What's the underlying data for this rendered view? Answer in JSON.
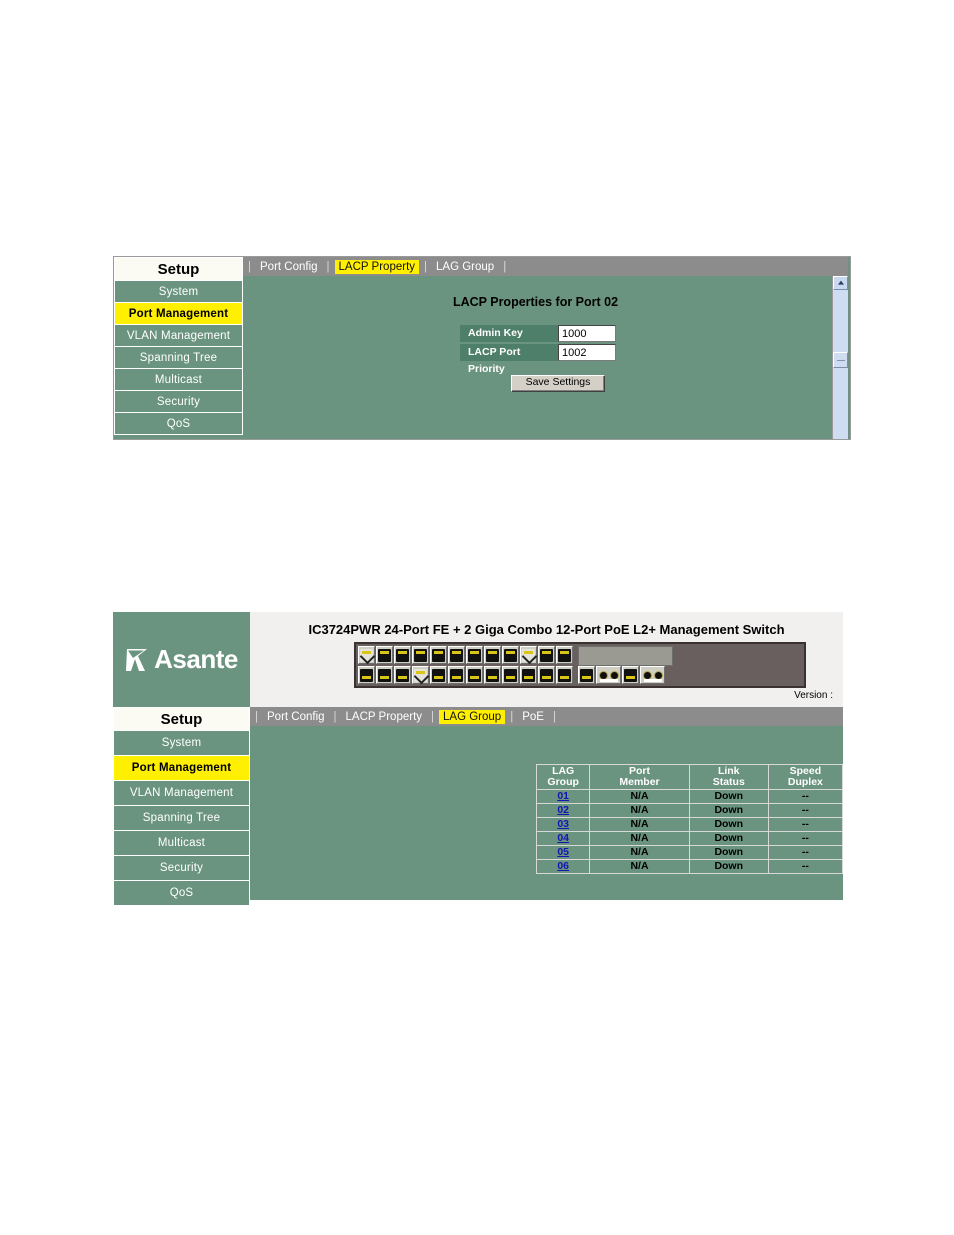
{
  "sidebar": {
    "header": "Setup",
    "items": [
      {
        "label": "System",
        "active": false
      },
      {
        "label": "Port Management",
        "active": true
      },
      {
        "label": "VLAN Management",
        "active": false
      },
      {
        "label": "Spanning Tree",
        "active": false
      },
      {
        "label": "Multicast",
        "active": false
      },
      {
        "label": "Security",
        "active": false
      },
      {
        "label": "QoS",
        "active": false
      }
    ]
  },
  "panel1": {
    "tabs": [
      {
        "label": "Port Config",
        "active": false
      },
      {
        "label": "LACP Property",
        "active": true
      },
      {
        "label": "LAG Group",
        "active": false
      }
    ],
    "title": "LACP Properties for Port 02",
    "fields": [
      {
        "label": "Admin Key",
        "value": "1000"
      },
      {
        "label": "LACP Port Priority",
        "value": "1002"
      }
    ],
    "save_label": "Save Settings"
  },
  "panel2": {
    "logo_text": "Asante",
    "device_title": "IC3724PWR 24-Port FE + 2 Giga Combo 12-Port PoE L2+ Management Switch",
    "version_label": "Version :",
    "tabs": [
      {
        "label": "Port Config",
        "active": false
      },
      {
        "label": "LACP Property",
        "active": false
      },
      {
        "label": "LAG Group",
        "active": true
      },
      {
        "label": "PoE",
        "active": false
      }
    ],
    "table": {
      "headers": [
        "LAG\nGroup",
        "Port\nMember",
        "Link\nStatus",
        "Speed\nDuplex"
      ],
      "rows": [
        {
          "id": "01",
          "port_member": "N/A",
          "link_status": "Down",
          "speed_duplex": "--"
        },
        {
          "id": "02",
          "port_member": "N/A",
          "link_status": "Down",
          "speed_duplex": "--"
        },
        {
          "id": "03",
          "port_member": "N/A",
          "link_status": "Down",
          "speed_duplex": "--"
        },
        {
          "id": "04",
          "port_member": "N/A",
          "link_status": "Down",
          "speed_duplex": "--"
        },
        {
          "id": "05",
          "port_member": "N/A",
          "link_status": "Down",
          "speed_duplex": "--"
        },
        {
          "id": "06",
          "port_member": "N/A",
          "link_status": "Down",
          "speed_duplex": "--"
        }
      ]
    }
  },
  "colors": {
    "panel_green": "#6b9480",
    "label_green": "#4e7f6b",
    "active_yellow": "#ffef00",
    "tabbar_gray": "#8c8c8c",
    "link_blue": "#1414b0"
  }
}
